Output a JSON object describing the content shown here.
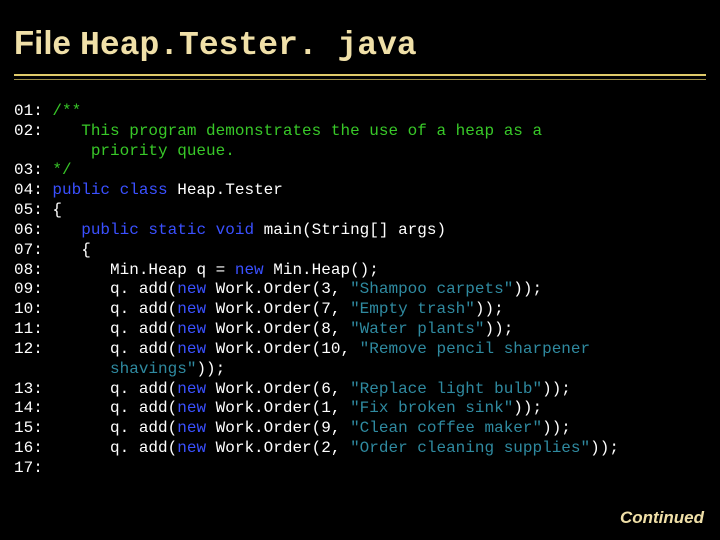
{
  "header": {
    "prefix": "File ",
    "filename": "Heap.Tester. java"
  },
  "code": {
    "lines": [
      {
        "no": "01:",
        "segs": [
          {
            "t": " ",
            "c": "id"
          },
          {
            "t": "/**",
            "c": "cm"
          }
        ]
      },
      {
        "no": "02:",
        "segs": [
          {
            "t": "    ",
            "c": "id"
          },
          {
            "t": "This program demonstrates the use of a heap as a",
            "c": "cm"
          }
        ]
      },
      {
        "no": "",
        "segs": [
          {
            "t": "        ",
            "c": "id"
          },
          {
            "t": "priority queue.",
            "c": "cm"
          }
        ]
      },
      {
        "no": "03:",
        "segs": [
          {
            "t": " ",
            "c": "id"
          },
          {
            "t": "*/",
            "c": "cm"
          }
        ]
      },
      {
        "no": "04:",
        "segs": [
          {
            "t": " ",
            "c": "id"
          },
          {
            "t": "public class ",
            "c": "kw"
          },
          {
            "t": "Heap.Tester",
            "c": "id"
          }
        ]
      },
      {
        "no": "05:",
        "segs": [
          {
            "t": " {",
            "c": "id"
          }
        ]
      },
      {
        "no": "06:",
        "segs": [
          {
            "t": "    ",
            "c": "id"
          },
          {
            "t": "public static void ",
            "c": "kw"
          },
          {
            "t": "main(String[] args)",
            "c": "id"
          }
        ]
      },
      {
        "no": "07:",
        "segs": [
          {
            "t": "    {",
            "c": "id"
          }
        ]
      },
      {
        "no": "08:",
        "segs": [
          {
            "t": "       Min.Heap q = ",
            "c": "id"
          },
          {
            "t": "new ",
            "c": "kw"
          },
          {
            "t": "Min.Heap();",
            "c": "id"
          }
        ]
      },
      {
        "no": "09:",
        "segs": [
          {
            "t": "       q. add(",
            "c": "id"
          },
          {
            "t": "new ",
            "c": "kw"
          },
          {
            "t": "Work.Order(3, ",
            "c": "id"
          },
          {
            "t": "\"Shampoo carpets\"",
            "c": "st"
          },
          {
            "t": "));",
            "c": "id"
          }
        ]
      },
      {
        "no": "10:",
        "segs": [
          {
            "t": "       q. add(",
            "c": "id"
          },
          {
            "t": "new ",
            "c": "kw"
          },
          {
            "t": "Work.Order(7, ",
            "c": "id"
          },
          {
            "t": "\"Empty trash\"",
            "c": "st"
          },
          {
            "t": "));",
            "c": "id"
          }
        ]
      },
      {
        "no": "11:",
        "segs": [
          {
            "t": "       q. add(",
            "c": "id"
          },
          {
            "t": "new ",
            "c": "kw"
          },
          {
            "t": "Work.Order(8, ",
            "c": "id"
          },
          {
            "t": "\"Water plants\"",
            "c": "st"
          },
          {
            "t": "));",
            "c": "id"
          }
        ]
      },
      {
        "no": "12:",
        "segs": [
          {
            "t": "       q. add(",
            "c": "id"
          },
          {
            "t": "new ",
            "c": "kw"
          },
          {
            "t": "Work.Order(10, ",
            "c": "id"
          },
          {
            "t": "\"Remove pencil sharpener",
            "c": "st"
          }
        ]
      },
      {
        "no": "",
        "segs": [
          {
            "t": "          ",
            "c": "id"
          },
          {
            "t": "shavings\"",
            "c": "st"
          },
          {
            "t": "));",
            "c": "id"
          }
        ]
      },
      {
        "no": "13:",
        "segs": [
          {
            "t": "       q. add(",
            "c": "id"
          },
          {
            "t": "new ",
            "c": "kw"
          },
          {
            "t": "Work.Order(6, ",
            "c": "id"
          },
          {
            "t": "\"Replace light bulb\"",
            "c": "st"
          },
          {
            "t": "));",
            "c": "id"
          }
        ]
      },
      {
        "no": "14:",
        "segs": [
          {
            "t": "       q. add(",
            "c": "id"
          },
          {
            "t": "new ",
            "c": "kw"
          },
          {
            "t": "Work.Order(1, ",
            "c": "id"
          },
          {
            "t": "\"Fix broken sink\"",
            "c": "st"
          },
          {
            "t": "));",
            "c": "id"
          }
        ]
      },
      {
        "no": "15:",
        "segs": [
          {
            "t": "       q. add(",
            "c": "id"
          },
          {
            "t": "new ",
            "c": "kw"
          },
          {
            "t": "Work.Order(9, ",
            "c": "id"
          },
          {
            "t": "\"Clean coffee maker\"",
            "c": "st"
          },
          {
            "t": "));",
            "c": "id"
          }
        ]
      },
      {
        "no": "16:",
        "segs": [
          {
            "t": "       q. add(",
            "c": "id"
          },
          {
            "t": "new ",
            "c": "kw"
          },
          {
            "t": "Work.Order(2, ",
            "c": "id"
          },
          {
            "t": "\"Order cleaning supplies\"",
            "c": "st"
          },
          {
            "t": "));",
            "c": "id"
          }
        ]
      },
      {
        "no": "17:",
        "segs": [
          {
            "t": " ",
            "c": "id"
          }
        ]
      }
    ]
  },
  "footer": {
    "continued": "Continued"
  }
}
